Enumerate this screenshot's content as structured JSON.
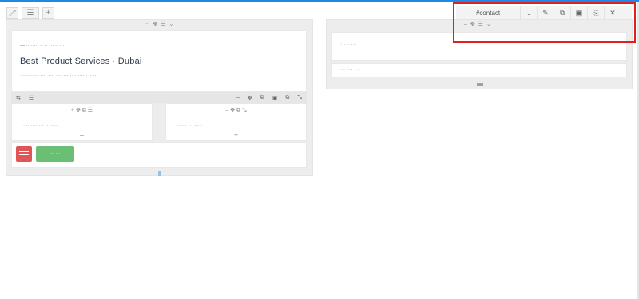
{
  "builder_tools": {
    "expand": "⤢",
    "menu": "☰",
    "add": "+"
  },
  "left_section": {
    "handle": "⋯ ✥ ☰ ⌄",
    "text_block": {
      "eyebrow": "— ·· ····· ·· ·· ··· ·· ····",
      "headline": "Best Product Services · Dubai",
      "desc": "············ ···· ···· ···· ······ ········ ·· ··"
    },
    "row_controls": {
      "left": [
        "⇆",
        "☰"
      ],
      "right": [
        "–",
        "✥",
        "⧉",
        "▣",
        "⧉",
        "⤡"
      ]
    },
    "col_a": {
      "head": "+ ✥ ⧉ ☰",
      "text": "· ··········· ·· ·····",
      "add": "–"
    },
    "col_b": {
      "head": "– ✥ ⧉ ⤡",
      "text": "······ ··· ·····",
      "add": "+"
    },
    "button_label": "··· ···"
  },
  "right_section": {
    "handle": "– ✥ ☰ ⌄",
    "card1_text": "··· ·····",
    "card2_text": "··· ···· · ·"
  },
  "section_toolbar": {
    "id_label": "#contact",
    "buttons": [
      "⌄",
      "✎",
      "⧉",
      "▣",
      "⎘",
      "✕"
    ]
  },
  "colors": {
    "accent": "#1e88e5",
    "highlight": "#e02020",
    "red_tile": "#e05656",
    "green_button": "#6bbf74"
  }
}
